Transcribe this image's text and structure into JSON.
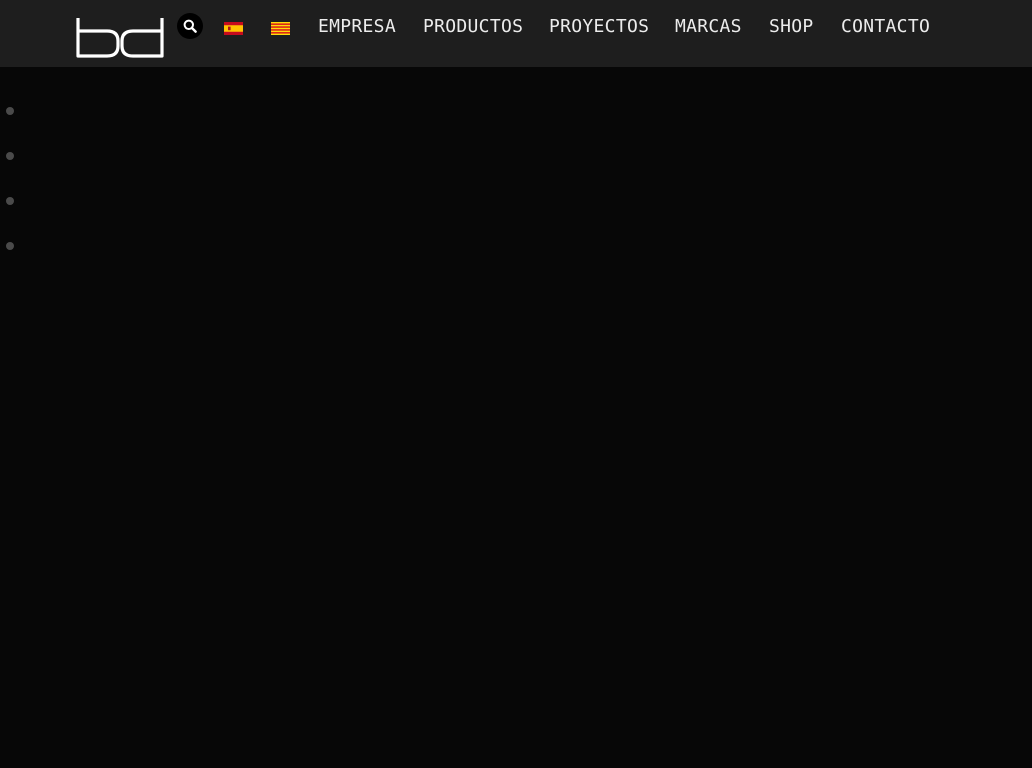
{
  "header": {
    "logo": {
      "text": "bd",
      "color": "#ffffff"
    },
    "search": {
      "icon": "search-icon"
    },
    "languages": [
      {
        "code": "es",
        "icon": "flag-spain-icon"
      },
      {
        "code": "ca",
        "icon": "flag-catalonia-icon"
      }
    ],
    "nav": {
      "empresa": "EMPRESA",
      "productos": "PRODUCTOS",
      "proyectos": "PROYECTOS",
      "marcas": "MARCAS",
      "shop": "SHOP",
      "contacto": "CONTACTO"
    }
  },
  "slider": {
    "dots": [
      "slide-1",
      "slide-2",
      "slide-3",
      "slide-4"
    ]
  },
  "colors": {
    "header_bg": "#1e1e1e",
    "page_bg": "#070707",
    "nav_text": "#ececec",
    "dot": "#4a4a4a"
  }
}
